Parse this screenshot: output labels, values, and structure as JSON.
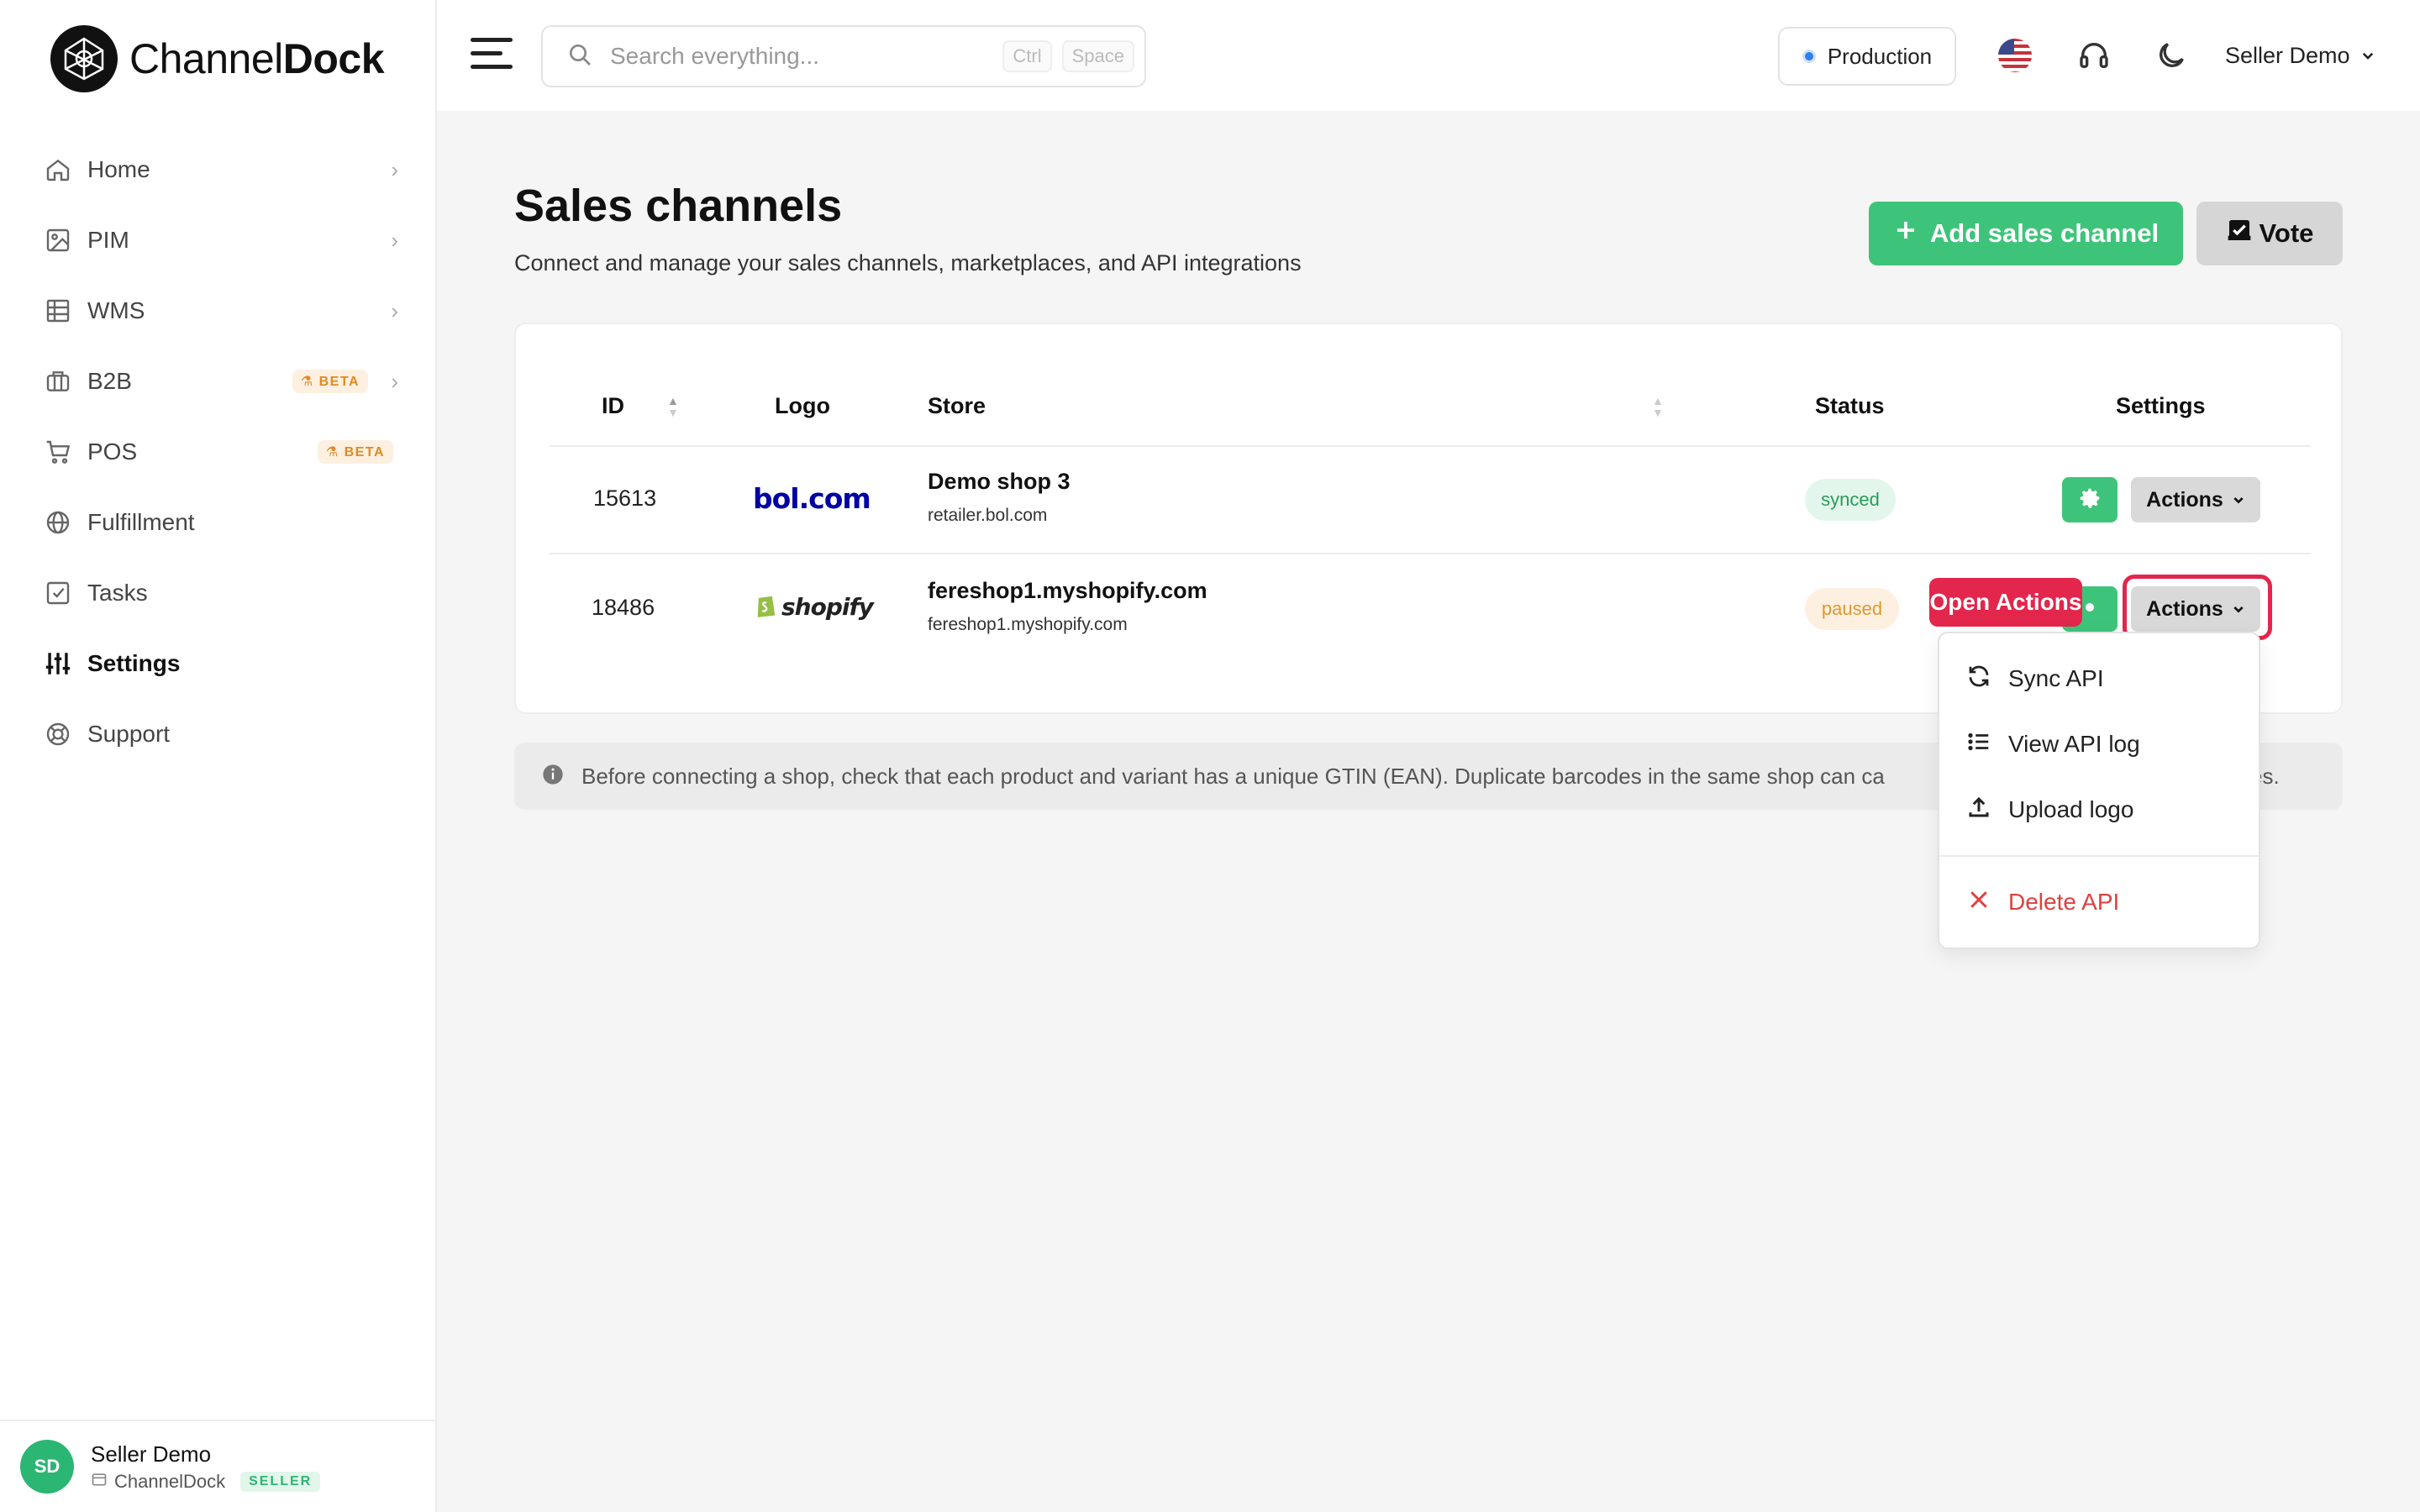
{
  "brand": {
    "name_light": "Channel",
    "name_bold": "Dock"
  },
  "sidebar": {
    "items": [
      {
        "label": "Home",
        "icon": "home-icon",
        "chevron": true
      },
      {
        "label": "PIM",
        "icon": "image-icon",
        "chevron": true
      },
      {
        "label": "WMS",
        "icon": "table-icon",
        "chevron": true
      },
      {
        "label": "B2B",
        "icon": "briefcase-icon",
        "chevron": true,
        "badge": "BETA"
      },
      {
        "label": "POS",
        "icon": "cart-icon",
        "chevron": false,
        "badge": "BETA"
      },
      {
        "label": "Fulfillment",
        "icon": "globe-icon",
        "chevron": false
      },
      {
        "label": "Tasks",
        "icon": "checkbox-icon",
        "chevron": false
      },
      {
        "label": "Settings",
        "icon": "sliders-icon",
        "chevron": false,
        "active": true
      },
      {
        "label": "Support",
        "icon": "lifebuoy-icon",
        "chevron": false
      }
    ],
    "user": {
      "initials": "SD",
      "name": "Seller Demo",
      "company": "ChannelDock",
      "role_badge": "SELLER"
    }
  },
  "header": {
    "search_placeholder": "Search everything...",
    "kbd1": "Ctrl",
    "kbd2": "Space",
    "environment": "Production",
    "user_name": "Seller Demo"
  },
  "main": {
    "title": "Sales channels",
    "subtitle": "Connect and manage your sales channels, marketplaces, and API integrations",
    "add_button": "Add sales channel",
    "vote_button": "Vote",
    "table": {
      "headers": {
        "id": "ID",
        "logo": "Logo",
        "store": "Store",
        "status": "Status",
        "settings": "Settings"
      },
      "rows": [
        {
          "id": "15613",
          "logo": "bol.com",
          "store_name": "Demo shop 3",
          "store_url": "retailer.bol.com",
          "status": "synced",
          "actions": "Actions"
        },
        {
          "id": "18486",
          "logo": "shopify",
          "store_name": "fereshop1.myshopify.com",
          "store_url": "fereshop1.myshopify.com",
          "status": "paused",
          "actions": "Actions"
        }
      ]
    },
    "info_text": "Before connecting a shop, check that each product and variant has a unique GTIN (EAN). Duplicate barcodes in the same shop can ca"
  },
  "info_tail": "es.",
  "overlay": {
    "tag": "Open Actions"
  },
  "dropdown": {
    "items": [
      {
        "label": "Sync API",
        "icon": "refresh-icon"
      },
      {
        "label": "View API log",
        "icon": "list-icon"
      },
      {
        "label": "Upload logo",
        "icon": "upload-icon"
      },
      {
        "label": "Delete API",
        "icon": "x-icon",
        "danger": true
      }
    ]
  },
  "colors": {
    "accent_green": "#3ec47a",
    "highlight_red": "#e3264c",
    "bol_blue": "#0000a4",
    "shopify_green": "#5e8e3e"
  }
}
